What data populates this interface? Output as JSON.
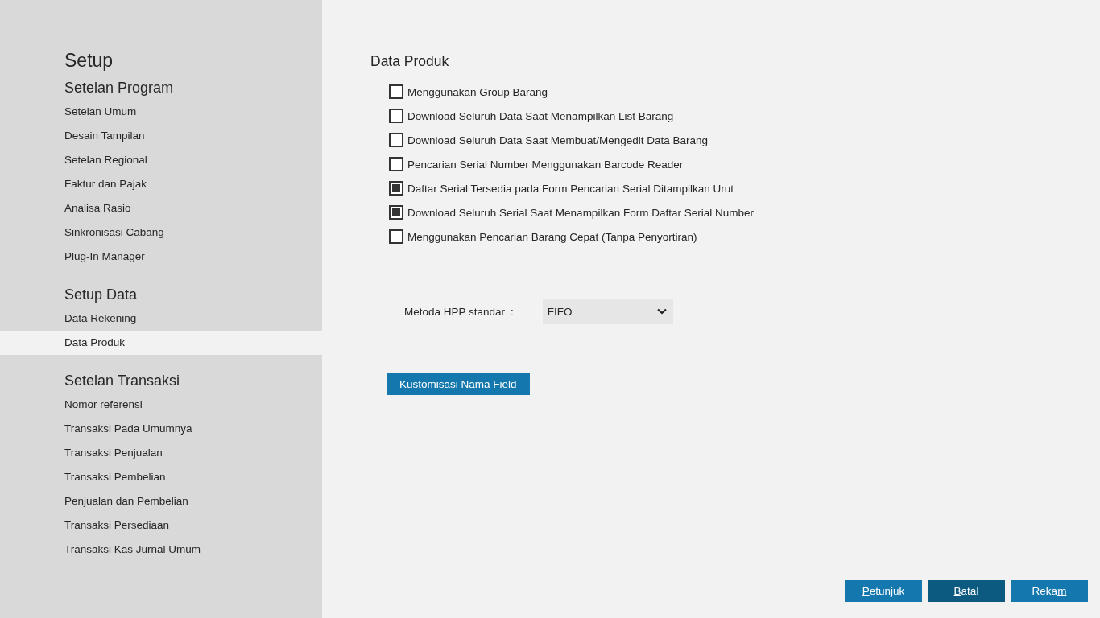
{
  "sidebar": {
    "title": "Setup",
    "sections": [
      {
        "heading": "Setelan Program",
        "items": [
          {
            "label": "Setelan Umum",
            "selected": false
          },
          {
            "label": "Desain Tampilan",
            "selected": false
          },
          {
            "label": "Setelan Regional",
            "selected": false
          },
          {
            "label": "Faktur dan Pajak",
            "selected": false
          },
          {
            "label": "Analisa Rasio",
            "selected": false
          },
          {
            "label": "Sinkronisasi Cabang",
            "selected": false
          },
          {
            "label": "Plug-In Manager",
            "selected": false
          }
        ]
      },
      {
        "heading": "Setup Data",
        "items": [
          {
            "label": "Data Rekening",
            "selected": false
          },
          {
            "label": "Data Produk",
            "selected": true
          }
        ]
      },
      {
        "heading": "Setelan Transaksi",
        "items": [
          {
            "label": "Nomor referensi",
            "selected": false
          },
          {
            "label": "Transaksi Pada Umumnya",
            "selected": false
          },
          {
            "label": "Transaksi Penjualan",
            "selected": false
          },
          {
            "label": "Transaksi Pembelian",
            "selected": false
          },
          {
            "label": "Penjualan dan Pembelian",
            "selected": false
          },
          {
            "label": "Transaksi Persediaan",
            "selected": false
          },
          {
            "label": "Transaksi Kas Jurnal Umum",
            "selected": false
          }
        ]
      }
    ]
  },
  "content": {
    "title": "Data Produk",
    "options": [
      {
        "label": "Menggunakan Group Barang",
        "checked": false
      },
      {
        "label": "Download Seluruh Data Saat Menampilkan List Barang",
        "checked": false
      },
      {
        "label": "Download Seluruh Data Saat Membuat/Mengedit Data Barang",
        "checked": false
      },
      {
        "label": "Pencarian Serial Number Menggunakan Barcode Reader",
        "checked": false
      },
      {
        "label": "Daftar Serial Tersedia pada Form Pencarian Serial Ditampilkan Urut",
        "checked": true
      },
      {
        "label": "Download Seluruh Serial Saat Menampilkan Form Daftar Serial Number",
        "checked": true
      },
      {
        "label": "Menggunakan Pencarian Barang Cepat (Tanpa Penyortiran)",
        "checked": false
      }
    ],
    "hpp_method": {
      "label": "Metoda HPP standar",
      "separator": ":",
      "value": "FIFO"
    },
    "customize_button": "Kustomisasi Nama Field"
  },
  "footer_buttons": [
    {
      "focused": false,
      "segments": [
        {
          "text": "P",
          "underlined": true
        },
        {
          "text": "etunjuk",
          "underlined": false
        }
      ]
    },
    {
      "focused": true,
      "segments": [
        {
          "text": "B",
          "underlined": true
        },
        {
          "text": "atal",
          "underlined": false
        }
      ]
    },
    {
      "focused": false,
      "segments": [
        {
          "text": "Reka",
          "underlined": false
        },
        {
          "text": "m",
          "underlined": true
        }
      ]
    }
  ]
}
